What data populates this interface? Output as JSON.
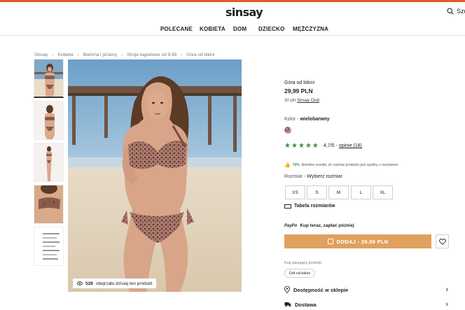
{
  "header": {
    "logo": "sinsay",
    "search_label": "Szu"
  },
  "nav": {
    "items": [
      "POLECANE",
      "KOBIETA",
      "DOM",
      "DZIECKO",
      "MĘŻCZYZNA"
    ]
  },
  "breadcrumb": [
    "Sinsay",
    "Kobieta",
    "Bielizna i piżamy",
    "Stroje kąpielowe od 9,99",
    "Góra od bikini"
  ],
  "gallery": {
    "viewers_count": "528",
    "viewers_text": "obejrzało dzisiaj ten produkt"
  },
  "product": {
    "name": "Góra od bikini",
    "price": "29,99 PLN",
    "club_points": "30 pkt",
    "club_link": "Sinsay Club",
    "color_label": "Kolor - ",
    "color_value": "wielobarwny",
    "rating": "4,7/5",
    "rating_sep": " - ",
    "reviews_link": "opinie (18)",
    "fit_percent": "70%",
    "fit_text": "klientów oceniło, że rozmiar produktu jest zgodny z rozmiarem",
    "size_label": "Rozmiar - ",
    "size_value": "Wybierz rozmiar",
    "sizes": [
      "XS",
      "S",
      "M",
      "L",
      "XL"
    ],
    "size_table": "Tabela rozmiarów",
    "paypo_logo": "PayPo",
    "paypo_text": "Kup teraz, zapłać później",
    "add_button": "DODAJ - 29,99 PLN",
    "matching_label": "Kup pasujący produkt",
    "matching_chip": "Dół od bikini",
    "availability": "Dostępność w sklepie",
    "delivery": "Dostawa"
  },
  "colors": {
    "accent": "#e25b2a",
    "add_button": "#e0a15f",
    "stars": "#3a8f49"
  }
}
